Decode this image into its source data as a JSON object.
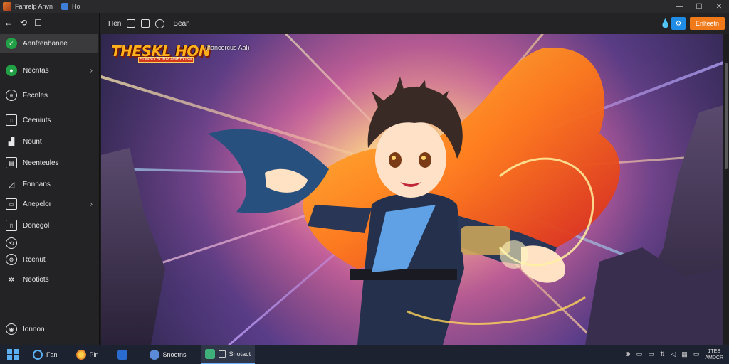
{
  "window": {
    "title": "Fanrelp Anvn",
    "tab_label": "Ho",
    "controls": [
      "—",
      "☐",
      "✕"
    ]
  },
  "sidebar": {
    "top_icons": [
      "←",
      "⟲",
      "☐"
    ],
    "items": [
      {
        "label": "Annfrenbanne",
        "icon": "app-icon",
        "active": true,
        "chevron": false
      },
      {
        "label": "Necntas",
        "icon": "news-icon",
        "active": false,
        "chevron": true
      },
      {
        "label": "Fecnles",
        "icon": "globe-icon",
        "active": false,
        "chevron": false
      },
      {
        "label": "Ceeniuts",
        "icon": "chat-icon",
        "active": false,
        "chevron": false
      },
      {
        "label": "Nount",
        "icon": "chart-icon",
        "active": false,
        "chevron": false
      },
      {
        "label": "Neenteules",
        "icon": "monitor-icon",
        "active": false,
        "chevron": false
      },
      {
        "label": "Fonnans",
        "icon": "trend-icon",
        "active": false,
        "chevron": false
      },
      {
        "label": "Anepelor",
        "icon": "folder-icon",
        "active": false,
        "chevron": true
      },
      {
        "label": "Donegol",
        "icon": "document-icon",
        "active": false,
        "chevron": false
      },
      {
        "label": "",
        "icon": "refresh-icon",
        "active": false,
        "chevron": false
      },
      {
        "label": "Rcenut",
        "icon": "settings-icon",
        "active": false,
        "chevron": false
      },
      {
        "label": "Neotiots",
        "icon": "gear-icon",
        "active": false,
        "chevron": false
      },
      {
        "label": "Ionnon",
        "icon": "account-icon",
        "active": false,
        "chevron": false
      }
    ]
  },
  "toolbar": {
    "first_label": "Hen",
    "second_label": "Bean",
    "right_button_label": "Enlteetn"
  },
  "artwork": {
    "logo_text": "THESKL HON",
    "logo_sub": "HONBO SORM AWREONA",
    "caption": "(hancorcus Aal)"
  },
  "taskbar": {
    "items": [
      {
        "label": "Fan",
        "color": "#3d8be0"
      },
      {
        "label": "Pin",
        "color": "#e07a2a"
      },
      {
        "label": "",
        "color": "#2a6bd0"
      },
      {
        "label": "Snoetns",
        "color": "#5a8ad8"
      },
      {
        "label": "Snotact",
        "color": "#3fb07a"
      }
    ],
    "tray_icons": [
      "⊗",
      "▭",
      "▭",
      "⇅",
      "◁",
      "▦",
      "▭"
    ],
    "clock_time": "1TES",
    "clock_date": "AMDCR"
  },
  "colors": {
    "accent_blue": "#1f8ce6",
    "accent_orange": "#f07a1a",
    "active_green": "#21a045"
  }
}
